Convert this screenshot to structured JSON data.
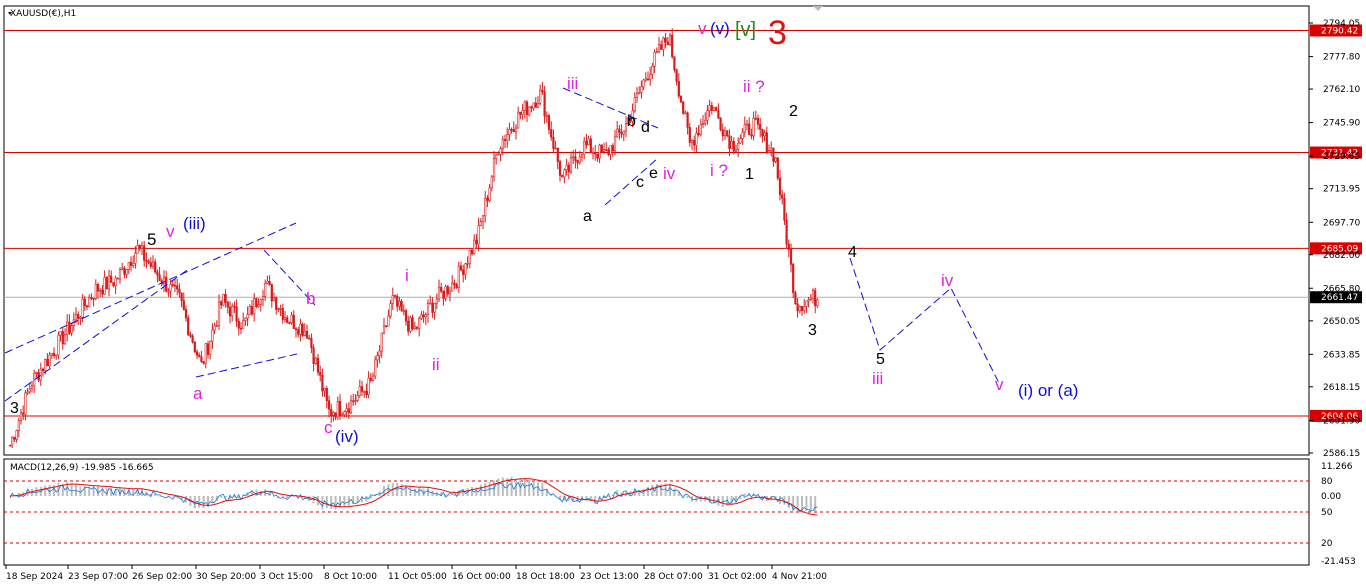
{
  "window": {
    "symbol_title": "XAUUSD(€),H1",
    "macd_title": "MACD(12,26,9) -19.985 -16.665"
  },
  "colors": {
    "candle": "#d81b1b",
    "hline": "#d80000",
    "magenta": "#e020e0",
    "blue": "#1010d0",
    "black": "#000000",
    "green": "#1a8f1a",
    "red": "#e01010",
    "macd_hist": "#bcbcbc",
    "macd_main": "#1878d8",
    "macd_signal": "#e01010"
  },
  "price_axis": {
    "ticks": [
      "2794.05",
      "2777.80",
      "2762.10",
      "2745.90",
      "2729.65",
      "2713.95",
      "2697.70",
      "2682.00",
      "2665.80",
      "2650.05",
      "2633.85",
      "2618.15",
      "2601.90",
      "2586.15"
    ]
  },
  "price_levels": [
    {
      "value": 2790.42,
      "label": "2790.42"
    },
    {
      "value": 2731.42,
      "label": "2731.42"
    },
    {
      "value": 2685.09,
      "label": "2685.09"
    },
    {
      "value": 2604.06,
      "label": "2604.06"
    }
  ],
  "current_price": {
    "value": 2661.47,
    "label": "2661.47"
  },
  "time_axis": {
    "labels": [
      "18 Sep 2024",
      "23 Sep 07:00",
      "26 Sep 02:00",
      "30 Sep 20:00",
      "3 Oct 15:00",
      "8 Oct 10:00",
      "11 Oct 05:00",
      "16 Oct 00:00",
      "18 Oct 18:00",
      "23 Oct 13:00",
      "28 Oct 07:00",
      "31 Oct 02:00",
      "4 Nov 21:00"
    ]
  },
  "macd_axis": {
    "ticks": [
      "11.266",
      "80",
      "0.00",
      "50",
      "20",
      "-21.453"
    ]
  },
  "wave_labels": {
    "p_3_start": "3",
    "p_5": "5",
    "p_v1": "v",
    "p_iii_blue": "(iii)",
    "p_a1": "a",
    "p_b1": "b",
    "p_c1": "c",
    "p_iv_blue": "(iv)",
    "p_i": "i",
    "p_ii": "ii",
    "p_iii_mag": "iii",
    "p_a2": "a",
    "p_b2": "b",
    "p_c2": "c",
    "p_d2": "d",
    "p_e2": "e",
    "p_iv_mag": "iv",
    "p_v_top": "v",
    "p_v_blue": "(v)",
    "p_v_green": "[v]",
    "p_3_red": "3",
    "p_iq": "i ?",
    "p_iiq": "ii ?",
    "p_1": "1",
    "p_2": "2",
    "p_3_low": "3",
    "p_4_proj": "4",
    "p_5_proj": "5",
    "p_iii_proj": "iii",
    "p_iv_proj": "iv",
    "p_v_proj": "v",
    "p_target": "(i) or (a)"
  },
  "chart_data": {
    "type": "candlestick",
    "title": "XAUUSD(€),H1",
    "ylim": [
      2580,
      2800
    ],
    "y_ticks": [
      2794.05,
      2777.8,
      2762.1,
      2745.9,
      2729.65,
      2713.95,
      2697.7,
      2682.0,
      2665.8,
      2650.05,
      2633.85,
      2618.15,
      2601.9,
      2586.15
    ],
    "x_tick_labels": [
      "18 Sep 2024",
      "23 Sep 07:00",
      "26 Sep 02:00",
      "30 Sep 20:00",
      "3 Oct 15:00",
      "8 Oct 10:00",
      "11 Oct 05:00",
      "16 Oct 00:00",
      "18 Oct 18:00",
      "23 Oct 13:00",
      "28 Oct 07:00",
      "31 Oct 02:00",
      "4 Nov 21:00"
    ],
    "close_path": [
      {
        "x": "18 Sep 2024",
        "y": 2590
      },
      {
        "x": "19 Sep",
        "y": 2620
      },
      {
        "x": "20 Sep",
        "y": 2635
      },
      {
        "x": "23 Sep 07:00",
        "y": 2650
      },
      {
        "x": "24 Sep",
        "y": 2665
      },
      {
        "x": "25 Sep",
        "y": 2670
      },
      {
        "x": "26 Sep 02:00",
        "y": 2685
      },
      {
        "x": "26 Sep",
        "y": 2672
      },
      {
        "x": "27 Sep",
        "y": 2660
      },
      {
        "x": "30 Sep 20:00",
        "y": 2628
      },
      {
        "x": "1 Oct",
        "y": 2660
      },
      {
        "x": "2 Oct",
        "y": 2648
      },
      {
        "x": "3 Oct 15:00",
        "y": 2668
      },
      {
        "x": "4 Oct",
        "y": 2652
      },
      {
        "x": "7 Oct",
        "y": 2645
      },
      {
        "x": "8 Oct 10:00",
        "y": 2606
      },
      {
        "x": "9 Oct",
        "y": 2610
      },
      {
        "x": "10 Oct",
        "y": 2620
      },
      {
        "x": "11 Oct 05:00",
        "y": 2660
      },
      {
        "x": "14 Oct",
        "y": 2645
      },
      {
        "x": "15 Oct",
        "y": 2660
      },
      {
        "x": "16 Oct 00:00",
        "y": 2670
      },
      {
        "x": "17 Oct",
        "y": 2690
      },
      {
        "x": "18 Oct 18:00",
        "y": 2735
      },
      {
        "x": "21 Oct",
        "y": 2750
      },
      {
        "x": "22 Oct",
        "y": 2760
      },
      {
        "x": "23 Oct 13:00",
        "y": 2718
      },
      {
        "x": "24 Oct",
        "y": 2735
      },
      {
        "x": "25 Oct",
        "y": 2730
      },
      {
        "x": "28 Oct 07:00",
        "y": 2745
      },
      {
        "x": "29 Oct",
        "y": 2770
      },
      {
        "x": "30 Oct",
        "y": 2788
      },
      {
        "x": "31 Oct 02:00",
        "y": 2735
      },
      {
        "x": "1 Nov",
        "y": 2755
      },
      {
        "x": "2 Nov",
        "y": 2735
      },
      {
        "x": "4 Nov 21:00",
        "y": 2745
      },
      {
        "x": "5 Nov",
        "y": 2730
      },
      {
        "x": "6 Nov",
        "y": 2658
      },
      {
        "x": "6 Nov late",
        "y": 2661.47
      }
    ],
    "macd": {
      "main": -19.985,
      "signal": -16.665
    }
  }
}
